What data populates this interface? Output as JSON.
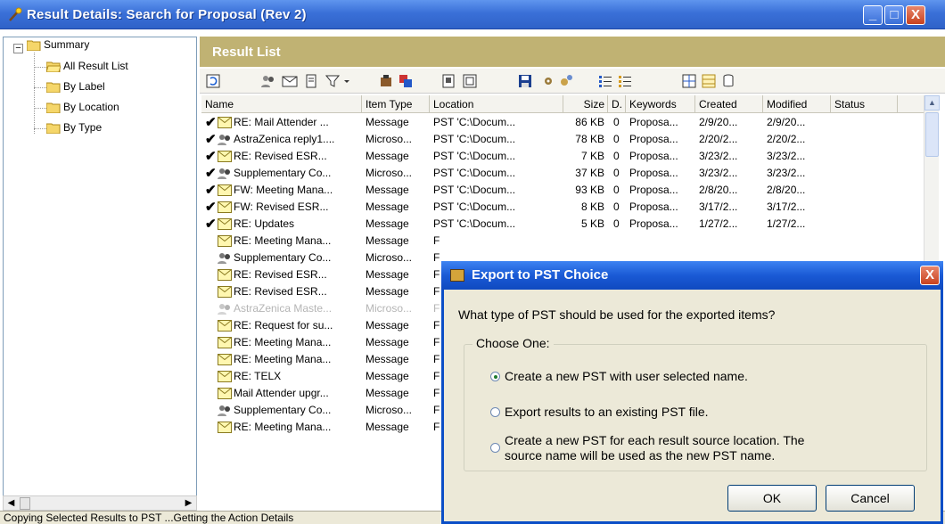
{
  "window": {
    "title": "Result Details:  Search for Proposal (Rev 2)",
    "min_label": "_",
    "max_label": "□",
    "close_label": "X"
  },
  "tree": {
    "expander": "−",
    "items": [
      {
        "label": "Summary"
      },
      {
        "label": "All Result List"
      },
      {
        "label": "By Label"
      },
      {
        "label": "By Location"
      },
      {
        "label": "By Type"
      }
    ]
  },
  "panel": {
    "title": "Result List"
  },
  "table": {
    "columns": [
      "Name",
      "Item Type",
      "Location",
      "Size",
      "D.",
      "Keywords",
      "Created",
      "Modified",
      "Status"
    ],
    "rows": [
      {
        "check": "✔",
        "icon": "mail",
        "name": "RE: Mail Attender ...",
        "type": "Message",
        "location": "PST 'C:\\Docum...",
        "size": "86 KB",
        "d": "0",
        "keywords": "Proposa...",
        "created": "2/9/20...",
        "modified": "2/9/20..."
      },
      {
        "check": "✔",
        "icon": "doc",
        "name": "AstraZenica reply1....",
        "type": "Microso...",
        "location": "PST 'C:\\Docum...",
        "size": "78 KB",
        "d": "0",
        "keywords": "Proposa...",
        "created": "2/20/2...",
        "modified": "2/20/2..."
      },
      {
        "check": "✔",
        "icon": "mail",
        "name": "RE: Revised ESR...",
        "type": "Message",
        "location": "PST 'C:\\Docum...",
        "size": "7 KB",
        "d": "0",
        "keywords": "Proposa...",
        "created": "3/23/2...",
        "modified": "3/23/2..."
      },
      {
        "check": "✔",
        "icon": "doc",
        "name": "Supplementary Co...",
        "type": "Microso...",
        "location": "PST 'C:\\Docum...",
        "size": "37 KB",
        "d": "0",
        "keywords": "Proposa...",
        "created": "3/23/2...",
        "modified": "3/23/2..."
      },
      {
        "check": "✔",
        "icon": "mail",
        "name": "FW: Meeting Mana...",
        "type": "Message",
        "location": "PST 'C:\\Docum...",
        "size": "93 KB",
        "d": "0",
        "keywords": "Proposa...",
        "created": "2/8/20...",
        "modified": "2/8/20..."
      },
      {
        "check": "✔",
        "icon": "mail",
        "name": "FW: Revised ESR...",
        "type": "Message",
        "location": "PST 'C:\\Docum...",
        "size": "8 KB",
        "d": "0",
        "keywords": "Proposa...",
        "created": "3/17/2...",
        "modified": "3/17/2..."
      },
      {
        "check": "✔",
        "icon": "mail",
        "name": "RE: Updates",
        "type": "Message",
        "location": "PST 'C:\\Docum...",
        "size": "5 KB",
        "d": "0",
        "keywords": "Proposa...",
        "created": "1/27/2...",
        "modified": "1/27/2..."
      },
      {
        "check": "",
        "icon": "mail",
        "name": "RE: Meeting Mana...",
        "type": "Message",
        "location": "F",
        "size": "",
        "d": "",
        "keywords": "",
        "created": "",
        "modified": ""
      },
      {
        "check": "",
        "icon": "doc",
        "name": "Supplementary Co...",
        "type": "Microso...",
        "location": "F",
        "size": "",
        "d": "",
        "keywords": "",
        "created": "",
        "modified": ""
      },
      {
        "check": "",
        "icon": "mail",
        "name": "RE: Revised ESR...",
        "type": "Message",
        "location": "F",
        "size": "",
        "d": "",
        "keywords": "",
        "created": "",
        "modified": ""
      },
      {
        "check": "",
        "icon": "mail",
        "name": "RE: Revised ESR...",
        "type": "Message",
        "location": "F",
        "size": "",
        "d": "",
        "keywords": "",
        "created": "",
        "modified": ""
      },
      {
        "check": "",
        "icon": "doc",
        "name": "AstraZenica Maste...",
        "type": "Microso...",
        "location": "F",
        "size": "",
        "d": "",
        "keywords": "",
        "created": "",
        "modified": "",
        "dim": true
      },
      {
        "check": "",
        "icon": "mail",
        "name": "RE: Request for su...",
        "type": "Message",
        "location": "F",
        "size": "",
        "d": "",
        "keywords": "",
        "created": "",
        "modified": ""
      },
      {
        "check": "",
        "icon": "mail",
        "name": "RE: Meeting Mana...",
        "type": "Message",
        "location": "F",
        "size": "",
        "d": "",
        "keywords": "",
        "created": "",
        "modified": ""
      },
      {
        "check": "",
        "icon": "mail",
        "name": "RE: Meeting Mana...",
        "type": "Message",
        "location": "F",
        "size": "",
        "d": "",
        "keywords": "",
        "created": "",
        "modified": ""
      },
      {
        "check": "",
        "icon": "mail",
        "name": "RE: TELX",
        "type": "Message",
        "location": "F",
        "size": "",
        "d": "",
        "keywords": "",
        "created": "",
        "modified": ""
      },
      {
        "check": "",
        "icon": "mail",
        "name": "Mail Attender upgr...",
        "type": "Message",
        "location": "F",
        "size": "",
        "d": "",
        "keywords": "",
        "created": "",
        "modified": ""
      },
      {
        "check": "",
        "icon": "doc",
        "name": "Supplementary Co...",
        "type": "Microso...",
        "location": "F",
        "size": "",
        "d": "",
        "keywords": "",
        "created": "",
        "modified": ""
      },
      {
        "check": "",
        "icon": "mail",
        "name": "RE: Meeting Mana...",
        "type": "Message",
        "location": "F",
        "size": "",
        "d": "",
        "keywords": "",
        "created": "",
        "modified": ""
      }
    ]
  },
  "status_bar": "Copying Selected Results to PST ...Getting the Action Details",
  "dialog": {
    "title": "Export to PST Choice",
    "close_label": "X",
    "question": "What type of PST should be used for the exported items?",
    "group_label": "Choose One:",
    "options": [
      {
        "label": "Create a new PST with user selected name.",
        "selected": true
      },
      {
        "label": "Export results to an existing PST file.",
        "selected": false
      },
      {
        "label_line1": "Create a new PST for each result source location.  The",
        "label_line2": "source name will be used as the new PST name.",
        "selected": false
      }
    ],
    "ok_label": "OK",
    "cancel_label": "Cancel"
  },
  "colors": {
    "title_blue": "#3a70d8",
    "panel_header": "#c0b273",
    "dialog_border": "#0a4ec7",
    "dialog_bg": "#ece9d8"
  }
}
